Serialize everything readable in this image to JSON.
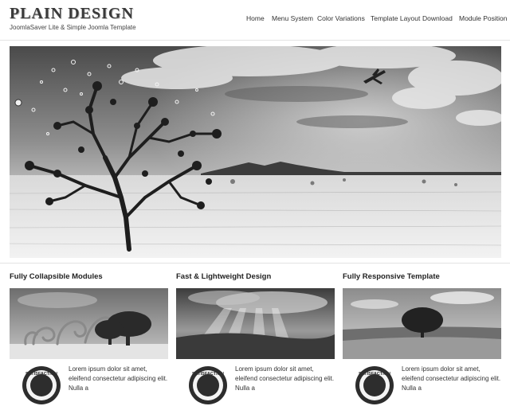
{
  "site": {
    "title": "PLAIN DESIGN",
    "subtitle": "JoomlaSaver Lite & Simple Joomla Template"
  },
  "nav": {
    "items": [
      {
        "label": "Home"
      },
      {
        "label": "Menu System"
      },
      {
        "label": "Color Variations"
      },
      {
        "label": "Template Layout"
      },
      {
        "label": "Download"
      },
      {
        "label": "Module Position"
      }
    ]
  },
  "features": [
    {
      "title": "Fully Collapsible Modules",
      "text": "Lorem ipsum dolor sit amet, eleifend consectetur adipiscing elit. Nulla a"
    },
    {
      "title": "Fast & Lightweight Design",
      "text": "Lorem ipsum dolor sit amet, eleifend consectetur adipiscing elit. Nulla a"
    },
    {
      "title": "Fully Responsive Template",
      "text": "Lorem ipsum dolor sit amet, eleifend consectetur adipiscing elit. Nulla a"
    }
  ],
  "badge": {
    "text": "SATISFACTION"
  },
  "colors": {
    "background": "#ffffff",
    "text": "#222222",
    "divider": "#e3e3e3",
    "photo_tone": "grayscale"
  }
}
